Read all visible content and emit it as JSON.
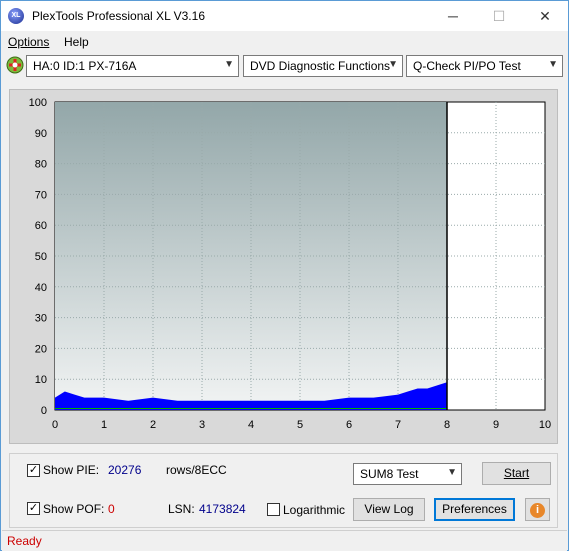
{
  "window": {
    "title": "PlexTools Professional XL V3.16",
    "app_icon_text": "XL",
    "minimize_glyph": "─",
    "maximize_glyph": "☐",
    "close_glyph": "✕"
  },
  "menu": [
    {
      "label": "Options"
    },
    {
      "label": "Help"
    }
  ],
  "toolbar": {
    "drive": "HA:0 ID:1  PX-716A",
    "function": "DVD Diagnostic Functions",
    "test": "Q-Check PI/PO Test"
  },
  "chart_data": {
    "type": "bar",
    "x_ticks": [
      "0",
      "1",
      "2",
      "3",
      "4",
      "5",
      "6",
      "7",
      "8",
      "9",
      "10"
    ],
    "y_ticks": [
      "0",
      "10",
      "20",
      "30",
      "40",
      "50",
      "60",
      "70",
      "80",
      "90",
      "100"
    ],
    "xlim": [
      0,
      10
    ],
    "ylim": [
      0,
      100
    ],
    "data_end_x": 8,
    "grid": true,
    "series": [
      {
        "color": "#0000ff"
      },
      {
        "color": "#00b000"
      }
    ],
    "pie_profile_x": [
      0,
      0.2,
      0.4,
      0.6,
      0.8,
      1,
      1.5,
      2,
      2.5,
      3,
      3.5,
      4,
      4.5,
      5,
      5.5,
      6,
      6.5,
      7,
      7.2,
      7.4,
      7.6,
      7.8,
      8
    ],
    "pie_profile_y": [
      4,
      6,
      5,
      4,
      4,
      4,
      3,
      4,
      3,
      3,
      3,
      3,
      3,
      3,
      3,
      4,
      4,
      5,
      6,
      7,
      7,
      8,
      9
    ]
  },
  "panel": {
    "show_pie_label": "Show PIE:",
    "pie_value": "20276",
    "pie_unit": "rows/8ECC",
    "show_pof_label": "Show POF:",
    "pof_value": "0",
    "lsn_label": "LSN:",
    "lsn_value": "4173824",
    "logarithmic_label": "Logarithmic",
    "sum_select": "SUM8 Test",
    "start_button": "Start",
    "view_log_button": "View Log",
    "preferences_button": "Preferences",
    "info_glyph": "i",
    "show_pie_checked": true,
    "show_pof_checked": true,
    "logarithmic_checked": false
  },
  "status": {
    "text": "Ready"
  },
  "colors": {
    "plot_top": "#93a7a9",
    "plot_bottom": "#f2f4f4",
    "pie": "#0000ff",
    "pof_value": "#cc0000",
    "status_text": "#cc0000",
    "blue_value": "#00008b"
  }
}
